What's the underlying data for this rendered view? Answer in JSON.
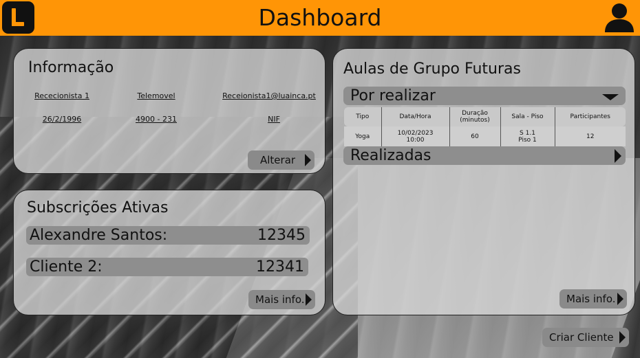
{
  "header": {
    "title": "Dashboard",
    "logo_letter": "L",
    "brand_color": "#ff9506",
    "user_icon": "user-icon"
  },
  "info_panel": {
    "title": "Informação",
    "row1": [
      "Rececionista 1",
      "Telemovel",
      "Receionista1@luainca.pt"
    ],
    "row2": [
      "26/2/1996",
      "4900 - 231",
      "NIF"
    ],
    "edit_button": "Alterar"
  },
  "subscriptions_panel": {
    "title": "Subscrições Ativas",
    "items": [
      {
        "name": "Alexandre Santos:",
        "number": "12345"
      },
      {
        "name": "Cliente 2:",
        "number": "12341"
      }
    ],
    "more_button": "Mais info."
  },
  "classes_panel": {
    "title": "Aulas de Grupo Futuras",
    "pending_section": "Por realizar",
    "columns": [
      "Tipo",
      "Data/Hora",
      "Duração (minutos)",
      "Sala - Piso",
      "Participantes"
    ],
    "rows": [
      {
        "tipo": "Yoga",
        "data": "10/02/2023",
        "hora": "10:00",
        "duracao": "60",
        "sala": "S 1.1",
        "piso": "Piso 1",
        "participantes": "12"
      }
    ],
    "done_section": "Realizadas",
    "more_button": "Mais info."
  },
  "footer": {
    "create_client_button": "Criar Cliente"
  }
}
